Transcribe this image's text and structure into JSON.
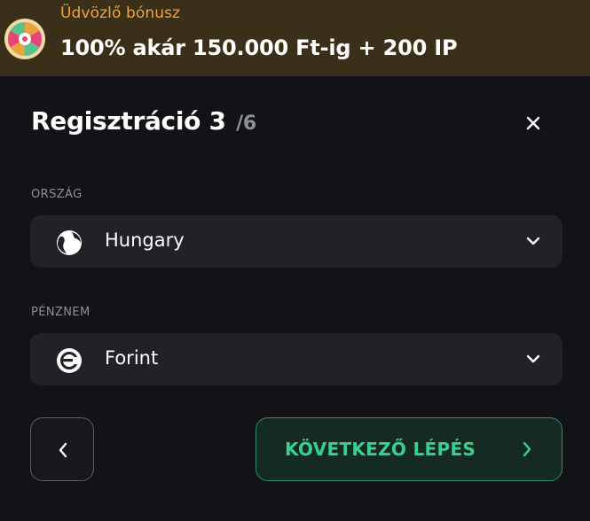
{
  "banner": {
    "title": "Üdvözlő bónusz",
    "text": "100% akár 150.000 Ft-ig + 200 IP",
    "icon": "prize-wheel-icon"
  },
  "registration": {
    "title": "Regisztráció 3",
    "step_total": "/6",
    "close_icon": "close-icon"
  },
  "country": {
    "label": "ORSZÁG",
    "value": "Hungary",
    "icon": "globe-icon"
  },
  "currency": {
    "label": "PÉNZNEM",
    "value": "Forint",
    "icon": "currency-icon"
  },
  "actions": {
    "back_icon": "chevron-left-icon",
    "next_label": "KÖVETKEZŐ LÉPÉS",
    "next_icon": "chevron-right-icon"
  },
  "colors": {
    "background": "#121316",
    "banner_bg": "#3a2f18",
    "banner_title": "#f2a33a",
    "field_bg": "#202227",
    "accent_green": "#35d28e"
  }
}
